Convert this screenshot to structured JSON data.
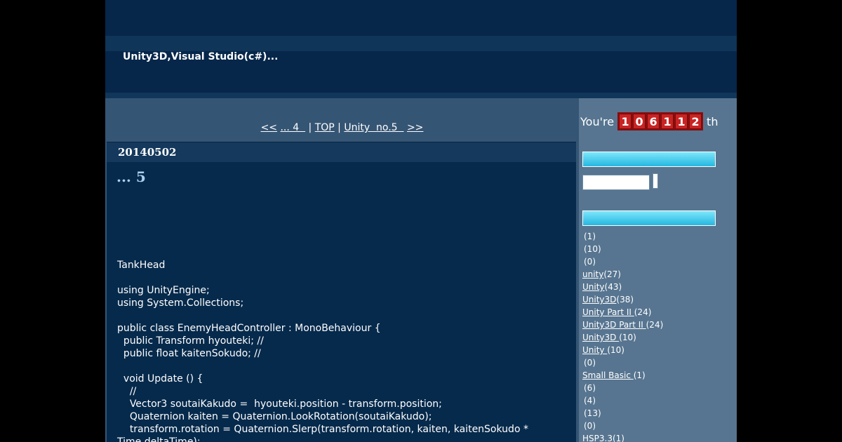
{
  "header": {
    "site_description": "Unity3D,Visual Studio(c#)..."
  },
  "pager": {
    "first": "<<",
    "prev": "... 4  ",
    "separator1": " | ",
    "top": "TOP",
    "separator2": " | ",
    "next": "Unity  no.5  ",
    "last": ">>"
  },
  "entry": {
    "date": "20140502",
    "title": "... 5",
    "body": "TankHead\n\nusing UnityEngine;\nusing System.Collections;\n\npublic class EnemyHeadController : MonoBehaviour {\n  public Transform hyouteki; //\n  public float kaitenSokudo; //\n\n  void Update () {\n    //\n    Vector3 soutaiKakudo =  hyouteki.position - transform.position;\n    Quaternion kaiten = Quaternion.LookRotation(soutaiKakudo);\n    transform.rotation = Quaternion.Slerp(transform.rotation, kaiten, kaitenSokudo *\nTime.deltaTime);"
  },
  "sidebar": {
    "counter_prefix": "You're",
    "counter_digits": [
      "1",
      "0",
      "6",
      "1",
      "1",
      "2"
    ],
    "counter_suffix": "th",
    "categories": [
      {
        "name": "",
        "count": "(1)"
      },
      {
        "name": "",
        "count": "(10)"
      },
      {
        "name": "",
        "count": "(0)"
      },
      {
        "name": "unity",
        "count": "(27)"
      },
      {
        "name": "Unity",
        "count": "(43)"
      },
      {
        "name": "Unity3D",
        "count": "(38)"
      },
      {
        "name": "Unity Part II ",
        "count": "(24)"
      },
      {
        "name": "Unity3D Part II ",
        "count": "(24)"
      },
      {
        "name": "Unity3D ",
        "count": "(10)"
      },
      {
        "name": "Unity ",
        "count": "(10)"
      },
      {
        "name": "",
        "count": "(0)"
      },
      {
        "name": "Small Basic ",
        "count": "(1)"
      },
      {
        "name": "",
        "count": "(6)"
      },
      {
        "name": "",
        "count": "(4)"
      },
      {
        "name": "",
        "count": "(13)"
      },
      {
        "name": "",
        "count": "(0)"
      },
      {
        "name": "HSP3.3",
        "count": "(1)"
      }
    ]
  }
}
